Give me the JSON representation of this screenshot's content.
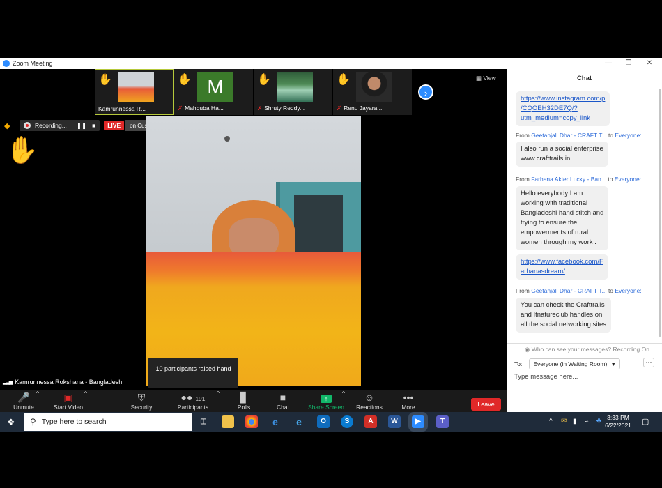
{
  "window": {
    "title": "Zoom Meeting"
  },
  "thumbnails": [
    {
      "name": "Kamrunnessa R...",
      "active": true,
      "muted": false
    },
    {
      "name": "Mahbuba Ha...",
      "initial": "M",
      "active": false,
      "muted": true
    },
    {
      "name": "Shruty Reddy...",
      "active": false,
      "muted": true
    },
    {
      "name": "Renu Jayara...",
      "active": false,
      "muted": true
    }
  ],
  "view_label": "View",
  "recording": {
    "label": "Recording...",
    "live_label": "LIVE",
    "stream_label": "on Custom Live Streaming Service"
  },
  "speaker_name": "Kamrunnessa Rokshana - Bangladesh",
  "tooltip": "10 participants raised hand",
  "toolbar": {
    "unmute": "Unmute",
    "start_video": "Start Video",
    "security": "Security",
    "participants": "Participants",
    "participants_count": "191",
    "polls": "Polls",
    "chat": "Chat",
    "share_screen": "Share Screen",
    "reactions": "Reactions",
    "more": "More",
    "leave": "Leave"
  },
  "chat": {
    "title": "Chat",
    "messages": {
      "m1_link": "https://www.instagram.com/p/CQOEH32DE7Q/?utm_medium=copy_link",
      "m1_lines": [
        "https://www.instagram.com/p",
        "/CQOEH32DE7Q/?",
        "utm_medium=copy_link"
      ],
      "from2_who": "Geetanjali Dhar - CRAFT T...",
      "from2_to": "Everyone:",
      "m2_lines": [
        "I also run a social enterprise",
        "www.crafttrails.in"
      ],
      "from3_who": "Farhana Akter Lucky - Ban...",
      "from3_to": "Everyone:",
      "m3_lines": [
        "Hello everybody I am",
        "working with traditional",
        "Bangladeshi hand stitch and",
        "trying to ensure the",
        "empowerments of rural",
        "women through my work ."
      ],
      "m4_lines": [
        "https://www.facebook.com/F",
        "arhanasdream/"
      ],
      "from5_who": "Geetanjali Dhar - CRAFT T...",
      "from5_to": "Everyone:",
      "m5_lines": [
        "You can check the Crafttrails",
        "and Itnatureclub handles on",
        "all the social networking sites"
      ]
    },
    "from_word": "From",
    "to_word": "to",
    "status": "Who can see your messages? Recording On",
    "to_label": "To:",
    "to_value": "Everyone (in Waiting Room)",
    "input_placeholder": "Type message here..."
  },
  "taskbar": {
    "search_placeholder": "Type here to search",
    "time": "3:33 PM",
    "date": "6/22/2021"
  },
  "colors": {
    "accent": "#2d8cff",
    "danger": "#e02828",
    "share": "#12b76a",
    "hand": "#f5c518"
  }
}
